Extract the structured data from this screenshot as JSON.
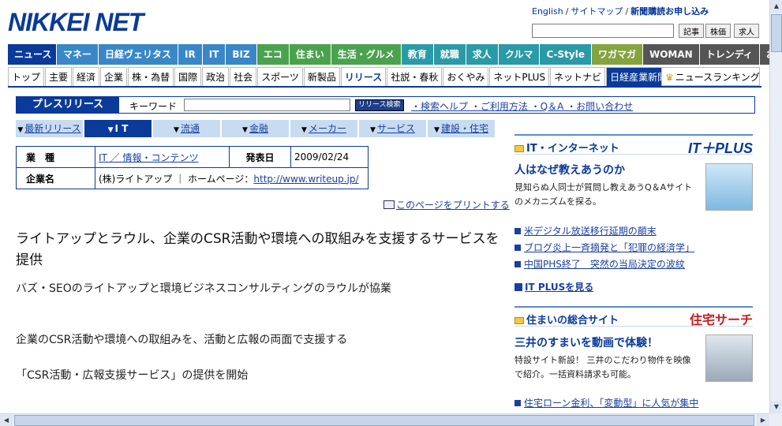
{
  "header": {
    "logo": "NIKKEI NET",
    "links": {
      "english": "English",
      "sitemap": "サイトマップ",
      "subscribe": "新聞購読お申し込み"
    },
    "search_buttons": [
      "記事",
      "株価",
      "求人"
    ]
  },
  "global_nav": [
    "ニュース",
    "マネー",
    "日経ヴェリタス",
    "IR",
    "IT",
    "BIZ",
    "エコ",
    "住まい",
    "生活・グルメ",
    "教育",
    "就職",
    "求人",
    "クルマ",
    "C-Style",
    "ワガマガ",
    "WOMAN",
    "トレンディ",
    "おとなのOFF"
  ],
  "sub_nav": [
    "トップ",
    "主要",
    "経済",
    "企業",
    "株・為替",
    "国際",
    "政治",
    "社会",
    "スポーツ",
    "新製品",
    "リリース",
    "社説・春秋",
    "おくやみ",
    "ネットPLUS",
    "ネットナビ",
    "日経産業新聞"
  ],
  "ranking": "ニュースランキング",
  "press": {
    "title": "プレスリリース",
    "keyword_label": "キーワード",
    "keyword_value": "",
    "search_button": "リリース検索",
    "help_links": "・検索ヘルプ ・ご利用方法 ・Q＆A ・お問い合わせ"
  },
  "category_tabs": [
    "最新リリース",
    "I T",
    "流通",
    "金融",
    "メーカー",
    "サービス",
    "建設・住宅"
  ],
  "info": {
    "industry_label": "業　種",
    "industry_value": "IT ／ 情報・コンテンツ",
    "date_label": "発表日",
    "date_value": "2009/02/24",
    "company_label": "企業名",
    "company_value": "(株)ライトアップ ｜ ホームページ：",
    "company_url": "http://www.writeup.jp/"
  },
  "print_link": "このページをプリントする",
  "article": {
    "headline": "ライトアップとラウル、企業のCSR活動や環境への取組みを支援するサービスを提供",
    "subhead": "バズ・SEOのライトアップと環境ビジネスコンサルティングのラウルが協業",
    "body1": "企業のCSR活動や環境への取組みを、活動と広報の両面で支援する",
    "body2": "「CSR活動・広報支援サービス」の提供を開始"
  },
  "sidebar": {
    "it": {
      "header": "IT・インターネット",
      "brand": "IT＋PLUS",
      "title": "人はなぜ教えあうのか",
      "desc": "見知らぬ人同士が質問し教えあうQ＆Aサイトのメカニズムを探る。",
      "items": [
        "米デジタル放送移行延期の顛末",
        "ブログ炎上一斉摘発と「犯罪の経済学」",
        "中国PHS終了　突然の当局決定の波紋"
      ],
      "more": "IT PLUSを見る"
    },
    "housing": {
      "header": "住まいの総合サイト",
      "brand": "住宅サーチ",
      "title": "三井のすまいを動画で体験！",
      "desc": "特設サイト新設！ 三井のこだわり物件を映像で紹介。一括資料請求も可能。",
      "items": [
        "住宅ローン金利、「変動型」に人気が集中"
      ]
    }
  }
}
